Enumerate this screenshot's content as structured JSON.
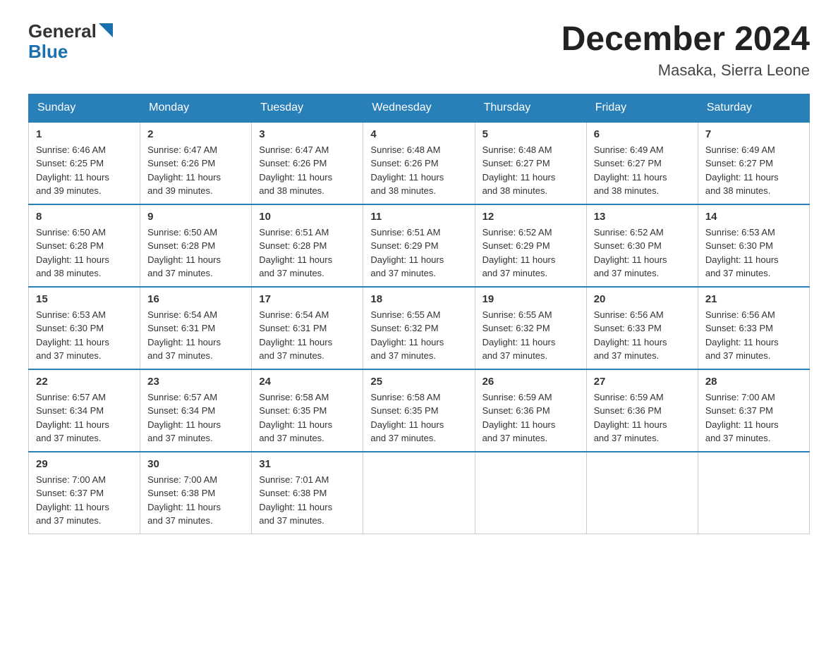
{
  "header": {
    "logo_general": "General",
    "logo_blue": "Blue",
    "title": "December 2024",
    "subtitle": "Masaka, Sierra Leone"
  },
  "weekdays": [
    "Sunday",
    "Monday",
    "Tuesday",
    "Wednesday",
    "Thursday",
    "Friday",
    "Saturday"
  ],
  "weeks": [
    [
      {
        "day": "1",
        "sunrise": "6:46 AM",
        "sunset": "6:25 PM",
        "daylight": "11 hours and 39 minutes."
      },
      {
        "day": "2",
        "sunrise": "6:47 AM",
        "sunset": "6:26 PM",
        "daylight": "11 hours and 39 minutes."
      },
      {
        "day": "3",
        "sunrise": "6:47 AM",
        "sunset": "6:26 PM",
        "daylight": "11 hours and 38 minutes."
      },
      {
        "day": "4",
        "sunrise": "6:48 AM",
        "sunset": "6:26 PM",
        "daylight": "11 hours and 38 minutes."
      },
      {
        "day": "5",
        "sunrise": "6:48 AM",
        "sunset": "6:27 PM",
        "daylight": "11 hours and 38 minutes."
      },
      {
        "day": "6",
        "sunrise": "6:49 AM",
        "sunset": "6:27 PM",
        "daylight": "11 hours and 38 minutes."
      },
      {
        "day": "7",
        "sunrise": "6:49 AM",
        "sunset": "6:27 PM",
        "daylight": "11 hours and 38 minutes."
      }
    ],
    [
      {
        "day": "8",
        "sunrise": "6:50 AM",
        "sunset": "6:28 PM",
        "daylight": "11 hours and 38 minutes."
      },
      {
        "day": "9",
        "sunrise": "6:50 AM",
        "sunset": "6:28 PM",
        "daylight": "11 hours and 37 minutes."
      },
      {
        "day": "10",
        "sunrise": "6:51 AM",
        "sunset": "6:28 PM",
        "daylight": "11 hours and 37 minutes."
      },
      {
        "day": "11",
        "sunrise": "6:51 AM",
        "sunset": "6:29 PM",
        "daylight": "11 hours and 37 minutes."
      },
      {
        "day": "12",
        "sunrise": "6:52 AM",
        "sunset": "6:29 PM",
        "daylight": "11 hours and 37 minutes."
      },
      {
        "day": "13",
        "sunrise": "6:52 AM",
        "sunset": "6:30 PM",
        "daylight": "11 hours and 37 minutes."
      },
      {
        "day": "14",
        "sunrise": "6:53 AM",
        "sunset": "6:30 PM",
        "daylight": "11 hours and 37 minutes."
      }
    ],
    [
      {
        "day": "15",
        "sunrise": "6:53 AM",
        "sunset": "6:30 PM",
        "daylight": "11 hours and 37 minutes."
      },
      {
        "day": "16",
        "sunrise": "6:54 AM",
        "sunset": "6:31 PM",
        "daylight": "11 hours and 37 minutes."
      },
      {
        "day": "17",
        "sunrise": "6:54 AM",
        "sunset": "6:31 PM",
        "daylight": "11 hours and 37 minutes."
      },
      {
        "day": "18",
        "sunrise": "6:55 AM",
        "sunset": "6:32 PM",
        "daylight": "11 hours and 37 minutes."
      },
      {
        "day": "19",
        "sunrise": "6:55 AM",
        "sunset": "6:32 PM",
        "daylight": "11 hours and 37 minutes."
      },
      {
        "day": "20",
        "sunrise": "6:56 AM",
        "sunset": "6:33 PM",
        "daylight": "11 hours and 37 minutes."
      },
      {
        "day": "21",
        "sunrise": "6:56 AM",
        "sunset": "6:33 PM",
        "daylight": "11 hours and 37 minutes."
      }
    ],
    [
      {
        "day": "22",
        "sunrise": "6:57 AM",
        "sunset": "6:34 PM",
        "daylight": "11 hours and 37 minutes."
      },
      {
        "day": "23",
        "sunrise": "6:57 AM",
        "sunset": "6:34 PM",
        "daylight": "11 hours and 37 minutes."
      },
      {
        "day": "24",
        "sunrise": "6:58 AM",
        "sunset": "6:35 PM",
        "daylight": "11 hours and 37 minutes."
      },
      {
        "day": "25",
        "sunrise": "6:58 AM",
        "sunset": "6:35 PM",
        "daylight": "11 hours and 37 minutes."
      },
      {
        "day": "26",
        "sunrise": "6:59 AM",
        "sunset": "6:36 PM",
        "daylight": "11 hours and 37 minutes."
      },
      {
        "day": "27",
        "sunrise": "6:59 AM",
        "sunset": "6:36 PM",
        "daylight": "11 hours and 37 minutes."
      },
      {
        "day": "28",
        "sunrise": "7:00 AM",
        "sunset": "6:37 PM",
        "daylight": "11 hours and 37 minutes."
      }
    ],
    [
      {
        "day": "29",
        "sunrise": "7:00 AM",
        "sunset": "6:37 PM",
        "daylight": "11 hours and 37 minutes."
      },
      {
        "day": "30",
        "sunrise": "7:00 AM",
        "sunset": "6:38 PM",
        "daylight": "11 hours and 37 minutes."
      },
      {
        "day": "31",
        "sunrise": "7:01 AM",
        "sunset": "6:38 PM",
        "daylight": "11 hours and 37 minutes."
      },
      null,
      null,
      null,
      null
    ]
  ],
  "labels": {
    "sunrise": "Sunrise:",
    "sunset": "Sunset:",
    "daylight": "Daylight:"
  }
}
